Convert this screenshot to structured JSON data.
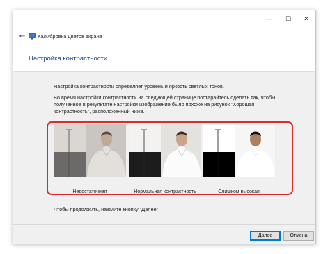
{
  "titlebar": {
    "minimize_glyph": "—",
    "maximize_glyph": "☐",
    "close_glyph": "✕"
  },
  "addressbar": {
    "back_glyph": "←",
    "app_icon": "display-calibration-icon",
    "title": "Калибровка цветов экрана"
  },
  "page": {
    "title": "Настройка контрастности",
    "paragraph_1": "Настройка контрастности определяет уровень и яркость светлых тонов.",
    "paragraph_2_line_1": "Во время настройки контрастности на следующей странице постарайтесь сделать так, чтобы",
    "paragraph_2_line_2": "полученное в результате настройки изображение было похоже на рисунок \"Хорошая",
    "paragraph_2_line_3": "контрастность\", расположенный ниже.",
    "instruction": "Чтобы продолжить, нажмите кнопку \"Далее\"."
  },
  "samples": [
    {
      "label": "Недостаточная"
    },
    {
      "label": "Нормальная контрастность"
    },
    {
      "label": "Слишком высокая"
    }
  ],
  "footer": {
    "next_label": "Далее",
    "cancel_label": "Отмена"
  },
  "colors": {
    "highlight": "#e02a2a",
    "title_blue": "#1e3f8a",
    "button_focus": "#0078d7"
  }
}
